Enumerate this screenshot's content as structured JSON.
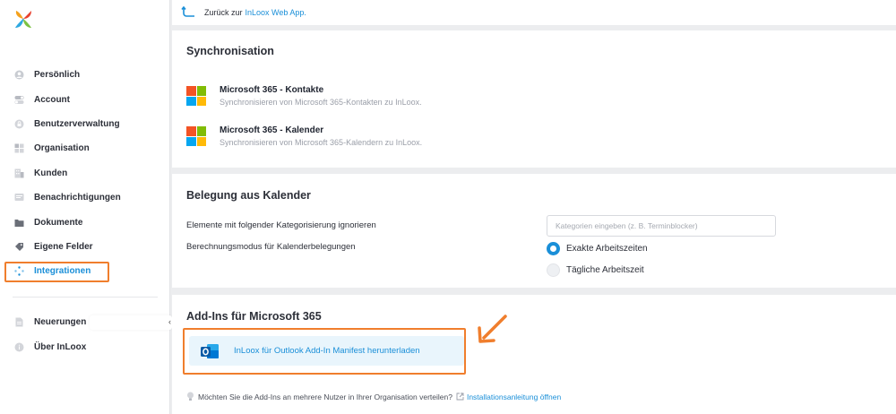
{
  "colors": {
    "accent": "#1a8fd8",
    "highlight": "#f07e2d"
  },
  "sidebar": {
    "items": [
      {
        "label": "Persönlich",
        "icon": "person-icon"
      },
      {
        "label": "Account",
        "icon": "toggle-icon"
      },
      {
        "label": "Benutzerverwaltung",
        "icon": "lock-icon"
      },
      {
        "label": "Organisation",
        "icon": "grid-icon"
      },
      {
        "label": "Kunden",
        "icon": "building-icon"
      },
      {
        "label": "Benachrichtigungen",
        "icon": "message-icon"
      },
      {
        "label": "Dokumente",
        "icon": "folder-icon"
      },
      {
        "label": "Eigene Felder",
        "icon": "tag-icon"
      },
      {
        "label": "Integrationen",
        "icon": "integrations-icon",
        "active": true
      }
    ],
    "secondary": [
      {
        "label": "Neuerungen",
        "icon": "document-icon"
      },
      {
        "label": "Über InLoox",
        "icon": "info-icon"
      }
    ],
    "collapse_glyph": "‹"
  },
  "back": {
    "prefix": "Zurück zur",
    "link": "InLoox Web App."
  },
  "sync": {
    "title": "Synchronisation",
    "items": [
      {
        "title": "Microsoft 365 - Kontakte",
        "subtitle": "Synchronisieren von Microsoft 365-Kontakten zu InLoox."
      },
      {
        "title": "Microsoft 365 - Kalender",
        "subtitle": "Synchronisieren von Microsoft 365-Kalendern zu InLoox."
      }
    ]
  },
  "calendar": {
    "title": "Belegung aus Kalender",
    "ignore_label": "Elemente mit folgender Kategorisierung ignorieren",
    "ignore_placeholder": "Kategorien eingeben (z. B. Terminblocker)",
    "ignore_value": "",
    "mode_label": "Berechnungsmodus für Kalenderbelegungen",
    "options": [
      {
        "label": "Exakte Arbeitszeiten",
        "checked": true
      },
      {
        "label": "Tägliche Arbeitszeit",
        "checked": false
      }
    ]
  },
  "addins": {
    "title": "Add-Ins für Microsoft 365",
    "download_label": "InLoox für Outlook Add-In Manifest herunterladen",
    "hint_text": "Möchten Sie die Add-Ins an mehrere Nutzer in Ihrer Organisation verteilen?",
    "hint_link": "Installationsanleitung öffnen"
  }
}
